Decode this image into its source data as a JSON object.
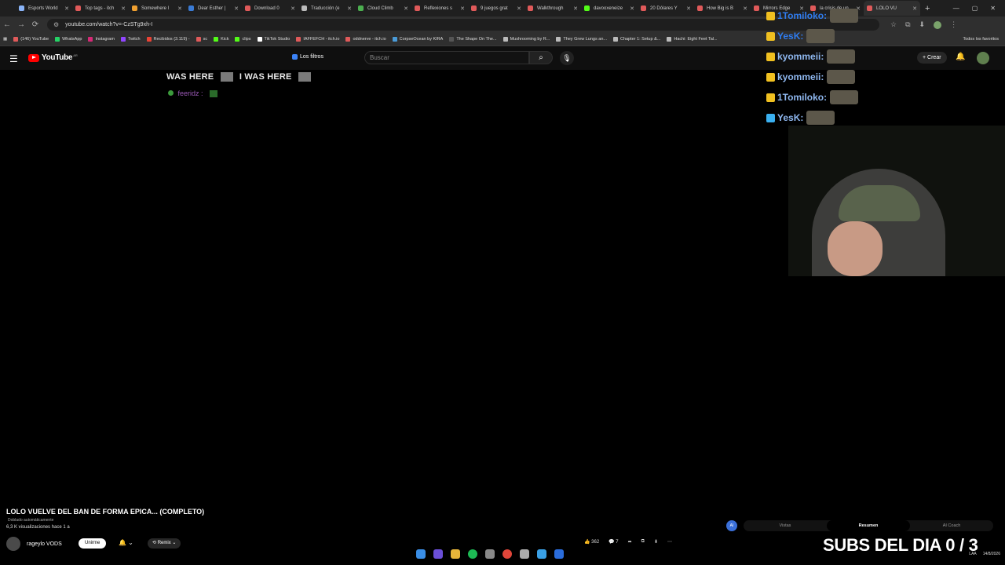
{
  "tabs": [
    {
      "label": "Esports World",
      "color": "#8ab4f8"
    },
    {
      "label": "Top tags - itch",
      "color": "#e05a5a"
    },
    {
      "label": "Somewhere l",
      "color": "#f0a030"
    },
    {
      "label": "Dear Esther |",
      "color": "#3a7bd5"
    },
    {
      "label": "Download 0",
      "color": "#e05a5a"
    },
    {
      "label": "Traducción (e",
      "color": "#bbbbbb"
    },
    {
      "label": "Cloud Climb",
      "color": "#4caf50"
    },
    {
      "label": "Reflexiones s",
      "color": "#e05a5a"
    },
    {
      "label": "9 juegos grat",
      "color": "#e05a5a"
    },
    {
      "label": "Walkthrough",
      "color": "#e05a5a"
    },
    {
      "label": "davooxeneize",
      "color": "#53fc18"
    },
    {
      "label": "20 Dólares Y",
      "color": "#e05a5a"
    },
    {
      "label": "How Big is B",
      "color": "#e05a5a"
    },
    {
      "label": "Mirrors Edge",
      "color": "#e05a5a"
    },
    {
      "label": "la crisis de un",
      "color": "#e05a5a"
    },
    {
      "label": "LOLO VU",
      "color": "#e05a5a",
      "active": true
    }
  ],
  "url": "youtube.com/watch?v=-CzSTg9xh-I",
  "bookmarks": [
    {
      "label": "(146) YouTube",
      "color": "#e05a5a"
    },
    {
      "label": "WhatsApp",
      "color": "#25d366"
    },
    {
      "label": "Instagram",
      "color": "#d62976"
    },
    {
      "label": "Twitch",
      "color": "#9146ff"
    },
    {
      "label": "Recibidos (3.119) -",
      "color": "#ea4335"
    },
    {
      "label": "sc",
      "color": "#e05a5a"
    },
    {
      "label": "Kick",
      "color": "#53fc18"
    },
    {
      "label": "clips",
      "color": "#53fc18"
    },
    {
      "label": "TikTok Studio",
      "color": "#ffffff"
    },
    {
      "label": "IAFFEFCH - itch.io",
      "color": "#e05a5a"
    },
    {
      "label": "oddnerve - itch.io",
      "color": "#e05a5a"
    },
    {
      "label": "CorpseOcean by KIRA",
      "color": "#4a9bd8"
    },
    {
      "label": "The Shape On The...",
      "color": "#555555"
    },
    {
      "label": "Mushrooming by R...",
      "color": "#bbbbbb"
    },
    {
      "label": "They Grew Lungs an...",
      "color": "#bbbbbb"
    },
    {
      "label": "Chapter 1: Setup &...",
      "color": "#bbbbbb"
    },
    {
      "label": "Hachi: Eight Feet Tal...",
      "color": "#bbbbbb"
    }
  ],
  "bookmarks_all": "Todos los favoritos",
  "youtube": {
    "logo": "YouTube",
    "region": "AR",
    "filters": "Los filtros",
    "search_placeholder": "Buscar",
    "create": "Crear"
  },
  "overlay": {
    "was_here_1": "WAS HERE",
    "was_here_2": "I WAS HERE",
    "chat_user": "feeridz :"
  },
  "chat": [
    {
      "user": "1Tomiloko:",
      "color": "#2f7cf0"
    },
    {
      "user": "YesK:",
      "color": "#2f7cf0"
    },
    {
      "user": "kyommeii:",
      "color": "#8fb8f0"
    },
    {
      "user": "kyommeii:",
      "color": "#8fb8f0"
    },
    {
      "user": "1Tomiloko:",
      "color": "#8fb8f0"
    },
    {
      "user": "YesK:",
      "color": "#8fb8f0"
    }
  ],
  "video": {
    "title": "LOLO VUELVE DEL BAN DE FORMA EPICA... (COMPLETO)",
    "dubbed": "Doblado automáticamente",
    "views": "6,3 K visualizaciones  hace 1 a",
    "channel": "rageylo VODS",
    "subscribe": "Unirme",
    "remix": "Remix",
    "likes": "362",
    "comments": "7"
  },
  "panel": {
    "tabs": [
      "Vistas",
      "Resumen",
      "AI Coach"
    ],
    "active": "Resumen"
  },
  "subs_overlay": "SUBS DEL DIA 0 / 3",
  "tray": {
    "lang": "LAA",
    "date": "14/8/2026"
  }
}
